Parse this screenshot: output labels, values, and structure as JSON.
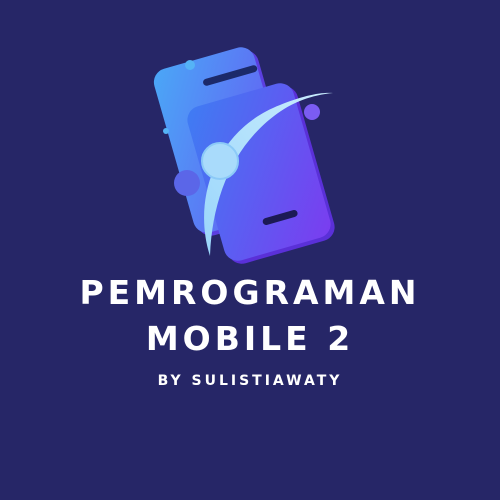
{
  "colors": {
    "background": "#262667",
    "text": "#ffffff",
    "accent_light": "#a8dcfb",
    "accent_blue": "#3aa0f5",
    "accent_purple": "#7b3cf0"
  },
  "logo": {
    "icon": "smartphone-icon"
  },
  "title": {
    "line1": "PEMROGRAMAN",
    "line2": "MOBILE 2"
  },
  "byline": "BY SULISTIAWATY"
}
